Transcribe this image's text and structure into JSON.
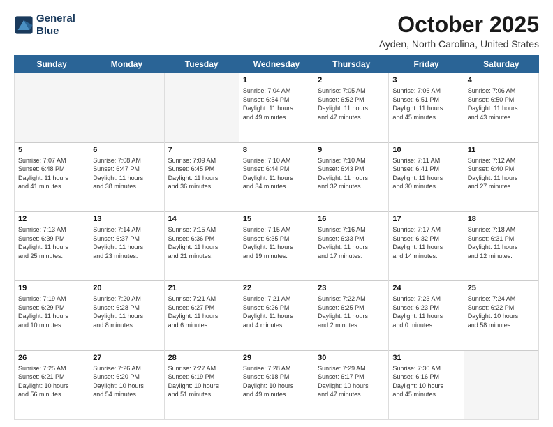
{
  "logo": {
    "line1": "General",
    "line2": "Blue"
  },
  "title": "October 2025",
  "subtitle": "Ayden, North Carolina, United States",
  "days_of_week": [
    "Sunday",
    "Monday",
    "Tuesday",
    "Wednesday",
    "Thursday",
    "Friday",
    "Saturday"
  ],
  "weeks": [
    [
      {
        "day": "",
        "info": ""
      },
      {
        "day": "",
        "info": ""
      },
      {
        "day": "",
        "info": ""
      },
      {
        "day": "1",
        "info": "Sunrise: 7:04 AM\nSunset: 6:54 PM\nDaylight: 11 hours\nand 49 minutes."
      },
      {
        "day": "2",
        "info": "Sunrise: 7:05 AM\nSunset: 6:52 PM\nDaylight: 11 hours\nand 47 minutes."
      },
      {
        "day": "3",
        "info": "Sunrise: 7:06 AM\nSunset: 6:51 PM\nDaylight: 11 hours\nand 45 minutes."
      },
      {
        "day": "4",
        "info": "Sunrise: 7:06 AM\nSunset: 6:50 PM\nDaylight: 11 hours\nand 43 minutes."
      }
    ],
    [
      {
        "day": "5",
        "info": "Sunrise: 7:07 AM\nSunset: 6:48 PM\nDaylight: 11 hours\nand 41 minutes."
      },
      {
        "day": "6",
        "info": "Sunrise: 7:08 AM\nSunset: 6:47 PM\nDaylight: 11 hours\nand 38 minutes."
      },
      {
        "day": "7",
        "info": "Sunrise: 7:09 AM\nSunset: 6:45 PM\nDaylight: 11 hours\nand 36 minutes."
      },
      {
        "day": "8",
        "info": "Sunrise: 7:10 AM\nSunset: 6:44 PM\nDaylight: 11 hours\nand 34 minutes."
      },
      {
        "day": "9",
        "info": "Sunrise: 7:10 AM\nSunset: 6:43 PM\nDaylight: 11 hours\nand 32 minutes."
      },
      {
        "day": "10",
        "info": "Sunrise: 7:11 AM\nSunset: 6:41 PM\nDaylight: 11 hours\nand 30 minutes."
      },
      {
        "day": "11",
        "info": "Sunrise: 7:12 AM\nSunset: 6:40 PM\nDaylight: 11 hours\nand 27 minutes."
      }
    ],
    [
      {
        "day": "12",
        "info": "Sunrise: 7:13 AM\nSunset: 6:39 PM\nDaylight: 11 hours\nand 25 minutes."
      },
      {
        "day": "13",
        "info": "Sunrise: 7:14 AM\nSunset: 6:37 PM\nDaylight: 11 hours\nand 23 minutes."
      },
      {
        "day": "14",
        "info": "Sunrise: 7:15 AM\nSunset: 6:36 PM\nDaylight: 11 hours\nand 21 minutes."
      },
      {
        "day": "15",
        "info": "Sunrise: 7:15 AM\nSunset: 6:35 PM\nDaylight: 11 hours\nand 19 minutes."
      },
      {
        "day": "16",
        "info": "Sunrise: 7:16 AM\nSunset: 6:33 PM\nDaylight: 11 hours\nand 17 minutes."
      },
      {
        "day": "17",
        "info": "Sunrise: 7:17 AM\nSunset: 6:32 PM\nDaylight: 11 hours\nand 14 minutes."
      },
      {
        "day": "18",
        "info": "Sunrise: 7:18 AM\nSunset: 6:31 PM\nDaylight: 11 hours\nand 12 minutes."
      }
    ],
    [
      {
        "day": "19",
        "info": "Sunrise: 7:19 AM\nSunset: 6:29 PM\nDaylight: 11 hours\nand 10 minutes."
      },
      {
        "day": "20",
        "info": "Sunrise: 7:20 AM\nSunset: 6:28 PM\nDaylight: 11 hours\nand 8 minutes."
      },
      {
        "day": "21",
        "info": "Sunrise: 7:21 AM\nSunset: 6:27 PM\nDaylight: 11 hours\nand 6 minutes."
      },
      {
        "day": "22",
        "info": "Sunrise: 7:21 AM\nSunset: 6:26 PM\nDaylight: 11 hours\nand 4 minutes."
      },
      {
        "day": "23",
        "info": "Sunrise: 7:22 AM\nSunset: 6:25 PM\nDaylight: 11 hours\nand 2 minutes."
      },
      {
        "day": "24",
        "info": "Sunrise: 7:23 AM\nSunset: 6:23 PM\nDaylight: 11 hours\nand 0 minutes."
      },
      {
        "day": "25",
        "info": "Sunrise: 7:24 AM\nSunset: 6:22 PM\nDaylight: 10 hours\nand 58 minutes."
      }
    ],
    [
      {
        "day": "26",
        "info": "Sunrise: 7:25 AM\nSunset: 6:21 PM\nDaylight: 10 hours\nand 56 minutes."
      },
      {
        "day": "27",
        "info": "Sunrise: 7:26 AM\nSunset: 6:20 PM\nDaylight: 10 hours\nand 54 minutes."
      },
      {
        "day": "28",
        "info": "Sunrise: 7:27 AM\nSunset: 6:19 PM\nDaylight: 10 hours\nand 51 minutes."
      },
      {
        "day": "29",
        "info": "Sunrise: 7:28 AM\nSunset: 6:18 PM\nDaylight: 10 hours\nand 49 minutes."
      },
      {
        "day": "30",
        "info": "Sunrise: 7:29 AM\nSunset: 6:17 PM\nDaylight: 10 hours\nand 47 minutes."
      },
      {
        "day": "31",
        "info": "Sunrise: 7:30 AM\nSunset: 6:16 PM\nDaylight: 10 hours\nand 45 minutes."
      },
      {
        "day": "",
        "info": ""
      }
    ]
  ]
}
